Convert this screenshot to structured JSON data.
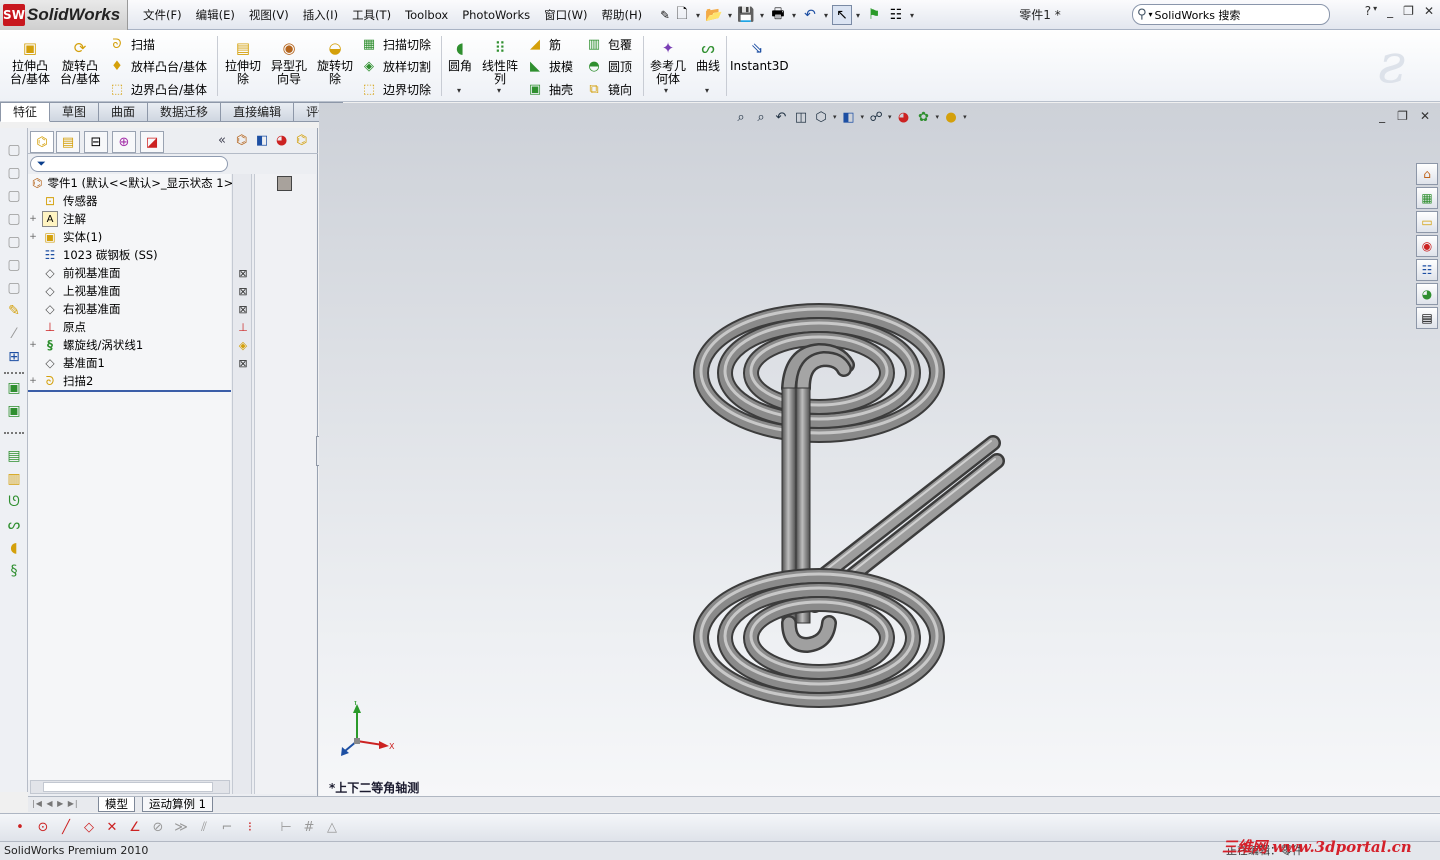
{
  "app": {
    "logo_text": "SolidWorks",
    "doc_title": "零件1 *",
    "search_placeholder": "SolidWorks 搜索",
    "colors": {
      "accent": "#c8171e",
      "tree_highlight": "#3b5ea8",
      "viewport_top": "#cdd1d8",
      "model": "#6f6f6f"
    }
  },
  "menu": [
    "文件(F)",
    "编辑(E)",
    "视图(V)",
    "插入(I)",
    "工具(T)",
    "Toolbox",
    "PhotoWorks",
    "窗口(W)",
    "帮助(H)"
  ],
  "ribbon": {
    "extrude_boss": "拉伸凸\n台/基体",
    "revolve_boss": "旋转凸\n台/基体",
    "sweep": "扫描",
    "loft_boss": "放样凸台/基体",
    "boundary_boss": "边界凸台/基体",
    "extrude_cut": "拉伸切\n除",
    "hole_wizard": "异型孔\n向导",
    "revolve_cut": "旋转切\n除",
    "sweep_cut": "扫描切除",
    "loft_cut": "放样切割",
    "boundary_cut": "边界切除",
    "fillet": "圆角",
    "linear_pattern": "线性阵\n列",
    "rib": "筋",
    "wrap": "包覆",
    "draft": "拔模",
    "dome": "圆顶",
    "shell": "抽壳",
    "mirror": "镜向",
    "ref_geometry": "参考几\n何体",
    "curves": "曲线",
    "instant3d": "Instant3D"
  },
  "tabs": [
    "特征",
    "草图",
    "曲面",
    "数据迁移",
    "直接编辑",
    "评估"
  ],
  "tree": {
    "items": [
      {
        "label": "零件1  (默认<<默认>_显示状态 1>",
        "icon": "part-icon",
        "expand": ""
      },
      {
        "label": "传感器",
        "icon": "sensor-icon",
        "expand": ""
      },
      {
        "label": "注解",
        "icon": "annotation-icon",
        "expand": "+"
      },
      {
        "label": "实体(1)",
        "icon": "solid-body-icon",
        "expand": "+"
      },
      {
        "label": "1023 碳钢板 (SS)",
        "icon": "material-icon",
        "expand": ""
      },
      {
        "label": "前视基准面",
        "icon": "plane-icon",
        "expand": ""
      },
      {
        "label": "上视基准面",
        "icon": "plane-icon",
        "expand": ""
      },
      {
        "label": "右视基准面",
        "icon": "plane-icon",
        "expand": ""
      },
      {
        "label": "原点",
        "icon": "origin-icon",
        "expand": ""
      },
      {
        "label": "螺旋线/涡状线1",
        "icon": "helix-icon",
        "expand": "+"
      },
      {
        "label": "基准面1",
        "icon": "plane-icon",
        "expand": ""
      },
      {
        "label": "扫描2",
        "icon": "sweep-icon",
        "expand": "+"
      }
    ]
  },
  "viewport": {
    "view_name": "*上下二等角轴测"
  },
  "bottom_tabs": [
    "模型",
    "运动算例 1"
  ],
  "status": {
    "left": "SolidWorks Premium 2010",
    "right": "正在编辑：零件",
    "watermark": "三维网 www.3dportal.cn"
  }
}
